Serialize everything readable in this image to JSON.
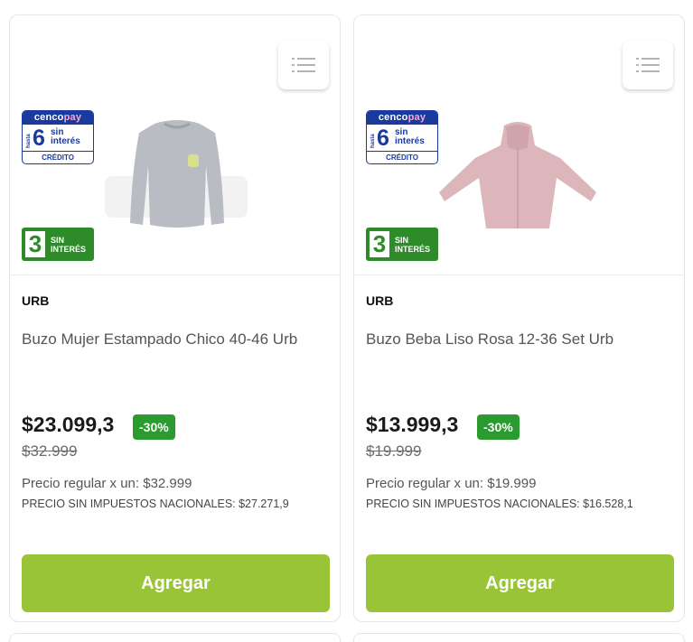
{
  "products": [
    {
      "brand": "URB",
      "name": "Buzo Mujer Estampado Chico 40-46 Urb",
      "price": "$23.099,3",
      "discount": "-30%",
      "old_price": "$32.999",
      "regular_price": "Precio regular x un: $32.999",
      "price_no_tax": "PRECIO SIN IMPUESTOS NACIONALES: $27.271,9",
      "add_label": "Agregar",
      "image_color": "#b9bcc2"
    },
    {
      "brand": "URB",
      "name": "Buzo Beba Liso Rosa 12-36 Set Urb",
      "price": "$13.999,3",
      "discount": "-30%",
      "old_price": "$19.999",
      "regular_price": "Precio regular x un: $19.999",
      "price_no_tax": "PRECIO SIN IMPUESTOS NACIONALES: $16.528,1",
      "add_label": "Agregar",
      "image_color": "#dcb6bb"
    }
  ],
  "badges": {
    "cencopay_brand_a": "cenco",
    "cencopay_brand_b": "pay",
    "cencopay_hasta": "hasta",
    "cencopay_num": "6",
    "cencopay_sin": "sin",
    "cencopay_interes": "interés",
    "cencopay_credito": "CRÉDITO",
    "sin3_num": "3",
    "sin3_sin": "SIN",
    "sin3_interes": "INTERÉS"
  },
  "colors": {
    "add_button": "#9ac438",
    "discount_badge": "#2b9a2f",
    "cencopay_blue": "#1a3a9e",
    "sin3_green": "#2e8b2a"
  },
  "icons": {
    "list": "list-icon"
  }
}
